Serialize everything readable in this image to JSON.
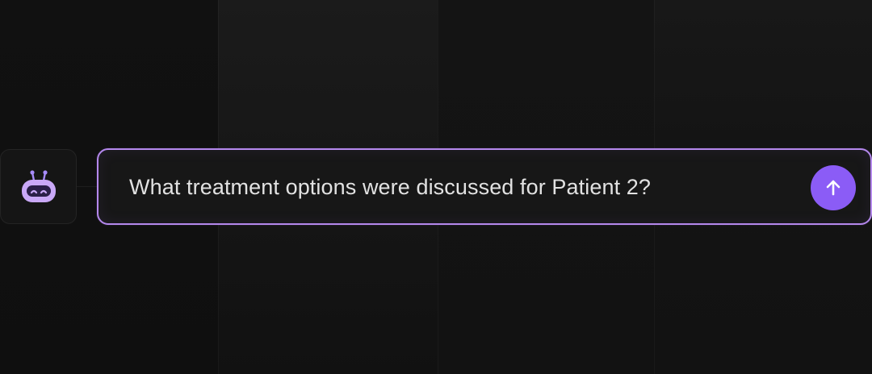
{
  "chat_input": {
    "value": "What treatment options were discussed for Patient 2?"
  },
  "icons": {
    "avatar": "robot-icon",
    "send": "arrow-up-icon"
  },
  "colors": {
    "accent": "#8b5cf6",
    "input_border": "#b488ec",
    "robot_face": "#c9a8f7",
    "robot_visor": "#2a1f48"
  }
}
